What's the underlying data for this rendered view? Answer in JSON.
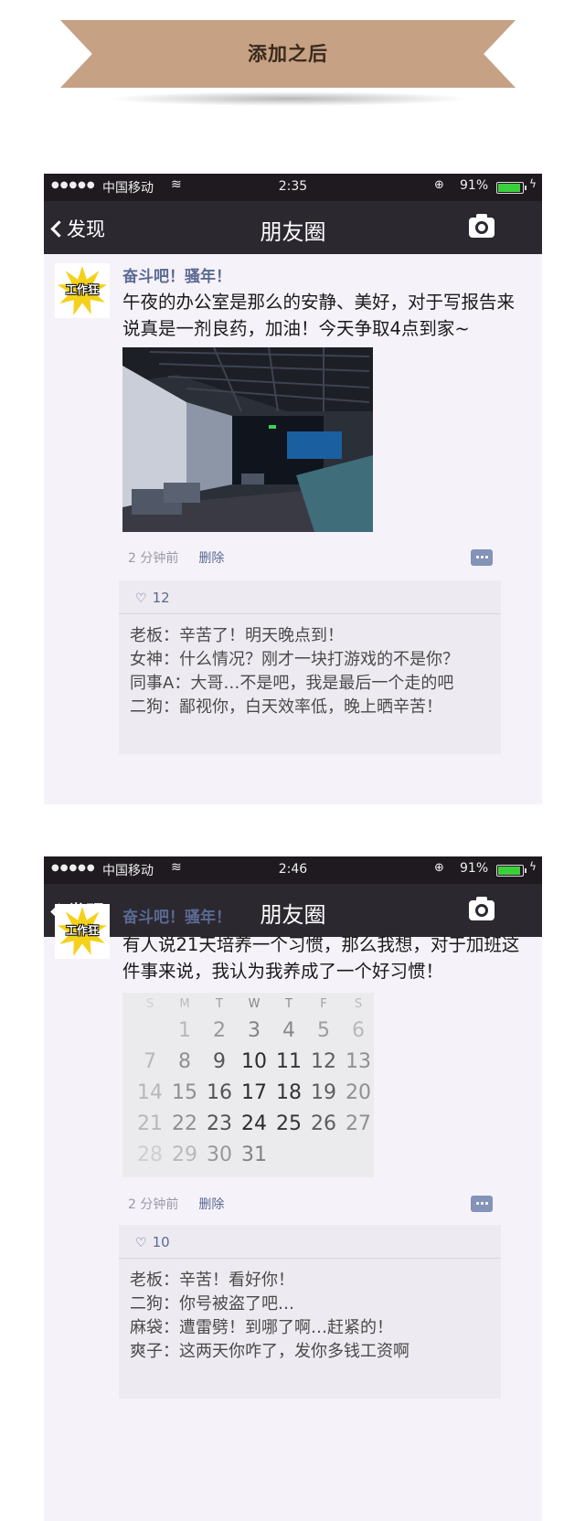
{
  "banner": {
    "title": "添加之后"
  },
  "posts": [
    {
      "status": {
        "signal": "●●●●●",
        "carrier": "中国移动",
        "wifi_icon": "wifi-icon",
        "time": "2:35",
        "lock_icon": "orientation-lock-icon",
        "battery_pct": "91%",
        "battery_level": 0.91
      },
      "nav": {
        "back_label": "发现",
        "title": "朋友圈",
        "camera_icon": "camera-icon"
      },
      "username": "奋斗吧！骚年！",
      "avatar_label": "工作狂",
      "text": "午夜的办公室是那么的安静、美好，对于写报告来说真是一剂良药，加油！今天争取4点到家~",
      "photo": "night-office-photo",
      "time_ago": "2 分钟前",
      "delete_label": "删除",
      "likes": "12",
      "comments": [
        {
          "author": "老板：",
          "text": "辛苦了！明天晚点到！"
        },
        {
          "author": "女神：",
          "text": "什么情况？刚才一块打游戏的不是你？"
        },
        {
          "author": "同事A：",
          "text": "大哥…不是吧，我是最后一个走的吧"
        },
        {
          "author": "二狗：",
          "text": "鄙视你，白天效率低，晚上晒辛苦！"
        }
      ]
    },
    {
      "status": {
        "signal": "●●●●●",
        "carrier": "中国移动",
        "wifi_icon": "wifi-icon",
        "time": "2:46",
        "lock_icon": "orientation-lock-icon",
        "battery_pct": "91%",
        "battery_level": 0.91
      },
      "nav": {
        "back_label": "发现",
        "title": "朋友圈",
        "camera_icon": "camera-icon"
      },
      "username": "奋斗吧！骚年！",
      "avatar_label": "工作狂",
      "text": "有人说21天培养一个习惯，那么我想，对于加班这件事来说，我认为我养成了一个好习惯！",
      "photo": "calendar-photo",
      "calendar": {
        "weekdays": [
          "S",
          "M",
          "T",
          "W",
          "T",
          "F",
          "S"
        ],
        "rows": [
          [
            "",
            "1",
            "2",
            "3",
            "4",
            "5",
            "6"
          ],
          [
            "7",
            "8",
            "9",
            "10",
            "11",
            "12",
            "13"
          ],
          [
            "14",
            "15",
            "16",
            "17",
            "18",
            "19",
            "20"
          ],
          [
            "21",
            "22",
            "23",
            "24",
            "25",
            "26",
            "27"
          ],
          [
            "28",
            "29",
            "30",
            "31",
            "",
            "",
            ""
          ]
        ]
      },
      "time_ago": "2 分钟前",
      "delete_label": "删除",
      "likes": "10",
      "comments": [
        {
          "author": "老板：",
          "text": "辛苦！看好你！"
        },
        {
          "author": "二狗：",
          "text": "你号被盗了吧…"
        },
        {
          "author": "麻袋：",
          "text": "遭雷劈！到哪了啊…赶紧的！"
        },
        {
          "author": "爽子：",
          "text": "这两天你咋了，发你多钱工资啊"
        }
      ]
    }
  ]
}
